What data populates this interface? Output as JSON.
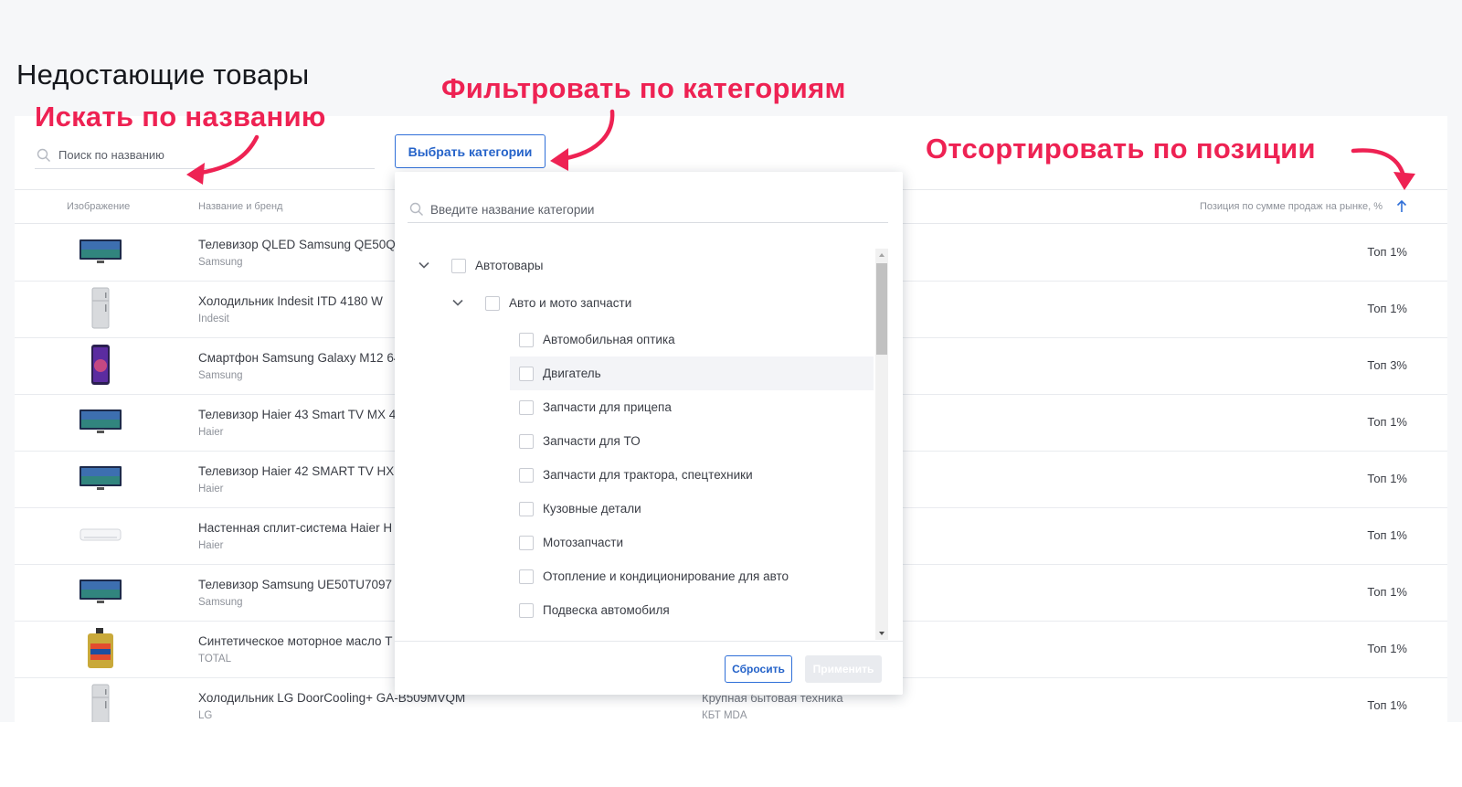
{
  "page": {
    "title": "Недостающие товары"
  },
  "search": {
    "placeholder": "Поиск по названию"
  },
  "category_button": {
    "label": "Выбрать категории"
  },
  "table": {
    "headers": {
      "image": "Изображение",
      "name_brand": "Название и бренд",
      "position": "Позиция по сумме продаж на рынке, %"
    },
    "rows": [
      {
        "name": "Телевизор QLED Samsung QE50Q",
        "brand": "Samsung",
        "category": "",
        "subcategory": "",
        "position": "Топ 1%",
        "thumb": "tv-icon"
      },
      {
        "name": "Холодильник Indesit ITD 4180 W",
        "brand": "Indesit",
        "category": "",
        "subcategory": "",
        "position": "Топ 1%",
        "thumb": "fridge-icon"
      },
      {
        "name": "Смартфон Samsung Galaxy M12 64",
        "brand": "Samsung",
        "category": "",
        "subcategory": "",
        "position": "Топ 3%",
        "thumb": "smartphone-icon"
      },
      {
        "name": "Телевизор Haier 43 Smart TV MX 4",
        "brand": "Haier",
        "category": "",
        "subcategory": "",
        "position": "Топ 1%",
        "thumb": "tv-icon"
      },
      {
        "name": "Телевизор Haier 42 SMART TV HX",
        "brand": "Haier",
        "category": "",
        "subcategory": "",
        "position": "Топ 1%",
        "thumb": "tv-icon"
      },
      {
        "name": "Настенная сплит-система Haier H",
        "brand": "Haier",
        "category": "",
        "subcategory": "",
        "position": "Топ 1%",
        "thumb": "air-conditioner-icon"
      },
      {
        "name": "Телевизор Samsung UE50TU7097",
        "brand": "Samsung",
        "category": "",
        "subcategory": "",
        "position": "Топ 1%",
        "thumb": "tv-icon"
      },
      {
        "name": "Синтетическое моторное масло T",
        "brand": "TOTAL",
        "category": "",
        "subcategory": "",
        "position": "Топ 1%",
        "thumb": "motor-oil-icon"
      },
      {
        "name": "Холодильник LG DoorCooling+ GA-B509MVQM",
        "brand": "LG",
        "category": "Крупная бытовая техника",
        "subcategory": "КБТ MDA",
        "position": "Топ 1%",
        "thumb": "fridge-icon"
      }
    ]
  },
  "dropdown": {
    "search_placeholder": "Введите название категории",
    "tree": [
      {
        "label": "Автотовары",
        "level": 0,
        "expanded": true
      },
      {
        "label": "Авто и мото запчасти",
        "level": 1,
        "expanded": true
      },
      {
        "label": "Автомобильная оптика",
        "level": 2
      },
      {
        "label": "Двигатель",
        "level": 2,
        "highlighted": true
      },
      {
        "label": "Запчасти для прицепа",
        "level": 2
      },
      {
        "label": "Запчасти для ТО",
        "level": 2
      },
      {
        "label": "Запчасти для трактора, спецтехники",
        "level": 2
      },
      {
        "label": "Кузовные детали",
        "level": 2
      },
      {
        "label": "Мотозапчасти",
        "level": 2
      },
      {
        "label": "Отопление и кондиционирование для авто",
        "level": 2
      },
      {
        "label": "Подвеска автомобиля",
        "level": 2
      }
    ],
    "reset_label": "Сбросить",
    "apply_label": "Применить"
  },
  "annotations": {
    "search_hint": "Искать по названию",
    "filter_hint": "Фильтровать по категориям",
    "sort_hint": "Отсортировать по позиции"
  },
  "colors": {
    "accent": "#2563c9",
    "annotation": "#ee2253",
    "background": "#f6f7f9"
  }
}
